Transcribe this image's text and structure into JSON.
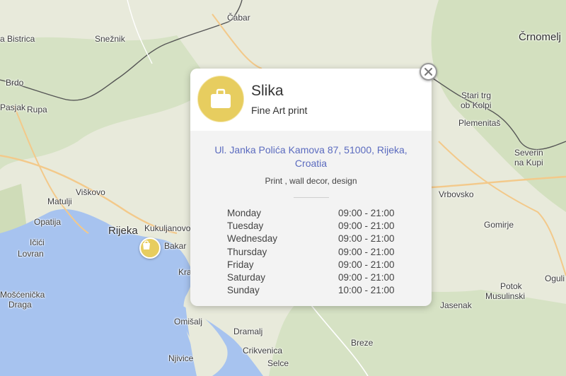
{
  "map": {
    "labels": {
      "cabar": "Čabar",
      "ilirska_bistrica": "a Bistrica",
      "sneznik": "Snežnik",
      "crnomelj": "Črnomelj",
      "brdo": "Brdo",
      "pasjak": "Pasjak",
      "rupa": "Rupa",
      "stari_trg_1": "Stari trg",
      "stari_trg_2": "ob Kolpi",
      "plemenitas": "Plemenitaš",
      "severin_1": "Severin",
      "severin_2": "na Kupi",
      "viskovo": "Viškovo",
      "matulji": "Matulji",
      "opatija": "Opatija",
      "rijeka": "Rijeka",
      "kukuljanovo": "Kukuljanovo",
      "icici": "Ičići",
      "lovran": "Lovran",
      "bakar": "Bakar",
      "kra": "Kra",
      "vrbovsko": "Vrbovsko",
      "gomirje": "Gomirje",
      "ogulin": "Oguli",
      "moscenicka_1": "Mošćenička",
      "moscenicka_2": "Draga",
      "omisalj": "Omišalj",
      "dramalj": "Dramalj",
      "potok_1": "Potok",
      "potok_2": "Musulinski",
      "jasenak": "Jasenak",
      "njivice": "Njivice",
      "crikvenica": "Crikvenica",
      "breze": "Breze",
      "selce": "Selce"
    }
  },
  "marker": {
    "icon": "shopping-bag-icon",
    "color": "#e7cd5f"
  },
  "popup": {
    "name": "Slika",
    "subtitle": "Fine Art print",
    "address": "Ul. Janka Polića Kamova 87, 51000, Rijeka, Croatia",
    "tags": "Print , wall decor, design",
    "avatar_icon": "briefcase-icon",
    "close_icon": "close-icon",
    "accent_color": "#e7cd5f",
    "link_color": "#5b6bbf",
    "hours": [
      {
        "day": "Monday",
        "time": "09:00 - 21:00"
      },
      {
        "day": "Tuesday",
        "time": "09:00 - 21:00"
      },
      {
        "day": "Wednesday",
        "time": "09:00 - 21:00"
      },
      {
        "day": "Thursday",
        "time": "09:00 - 21:00"
      },
      {
        "day": "Friday",
        "time": "09:00 - 21:00"
      },
      {
        "day": "Saturday",
        "time": "09:00 - 21:00"
      },
      {
        "day": "Sunday",
        "time": "10:00 - 21:00"
      }
    ]
  }
}
